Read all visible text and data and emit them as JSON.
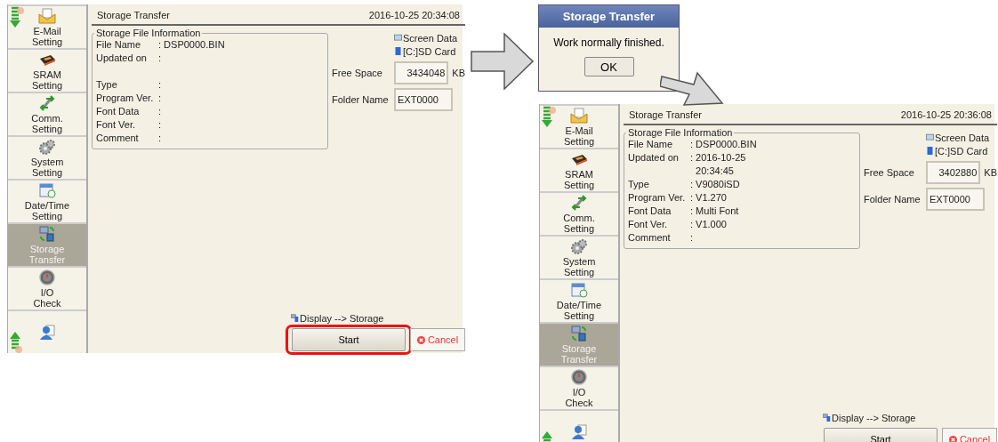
{
  "screens": [
    {
      "title": "Storage Transfer",
      "datetime": "2016-10-25  20:34:08",
      "sidebar": [
        {
          "label": "E-Mail\nSetting",
          "kind": "email",
          "selected": false
        },
        {
          "label": "SRAM\nSetting",
          "kind": "sram",
          "selected": false
        },
        {
          "label": "Comm.\nSetting",
          "kind": "comm",
          "selected": false
        },
        {
          "label": "System\nSetting",
          "kind": "system",
          "selected": false
        },
        {
          "label": "Date/Time\nSetting",
          "kind": "datetime",
          "selected": false
        },
        {
          "label": "Storage\nTransfer",
          "kind": "storage",
          "selected": true
        },
        {
          "label": "I/O\nCheck",
          "kind": "io",
          "selected": false
        },
        {
          "kind": "user",
          "selected": false
        }
      ],
      "info": {
        "title": "Storage File Information",
        "fields": [
          {
            "label": "File Name",
            "value": ": DSP0000.BIN"
          },
          {
            "label": "Updated on",
            "value": ":\n "
          },
          {
            "label": "Type",
            "value": ":"
          },
          {
            "label": "Program Ver.",
            "value": ":"
          },
          {
            "label": "Font Data",
            "value": ":"
          },
          {
            "label": "Font Ver.",
            "value": ":"
          },
          {
            "label": "Comment",
            "value": ":"
          }
        ]
      },
      "sources": [
        {
          "label": "Screen Data",
          "kind": "monitor"
        },
        {
          "label": "[C:]SD Card",
          "kind": "sdcard"
        }
      ],
      "free_space": {
        "label": "Free Space",
        "value": "3434048",
        "unit": "KB"
      },
      "folder": {
        "label": "Folder Name",
        "value": "EXT0000"
      },
      "direction": "Display --> Storage",
      "start": {
        "label": "Start",
        "highlighted": true
      },
      "cancel": {
        "label": "Cancel"
      }
    },
    {
      "title": "Storage Transfer",
      "datetime": "2016-10-25  20:36:08",
      "sidebar": [
        {
          "label": "E-Mail\nSetting",
          "kind": "email",
          "selected": false
        },
        {
          "label": "SRAM\nSetting",
          "kind": "sram",
          "selected": false
        },
        {
          "label": "Comm.\nSetting",
          "kind": "comm",
          "selected": false
        },
        {
          "label": "System\nSetting",
          "kind": "system",
          "selected": false
        },
        {
          "label": "Date/Time\nSetting",
          "kind": "datetime",
          "selected": false
        },
        {
          "label": "Storage\nTransfer",
          "kind": "storage",
          "selected": true
        },
        {
          "label": "I/O\nCheck",
          "kind": "io",
          "selected": false
        },
        {
          "kind": "user",
          "selected": false
        }
      ],
      "info": {
        "title": "Storage File Information",
        "fields": [
          {
            "label": "File Name",
            "value": ": DSP0000.BIN"
          },
          {
            "label": "Updated on",
            "value": ": 2016-10-25\n  20:34:45"
          },
          {
            "label": "Type",
            "value": ": V9080iSD"
          },
          {
            "label": "Program Ver.",
            "value": ": V1.270"
          },
          {
            "label": "Font Data",
            "value": ": Multi Font"
          },
          {
            "label": "Font Ver.",
            "value": ": V1.000"
          },
          {
            "label": "Comment",
            "value": ":"
          }
        ]
      },
      "sources": [
        {
          "label": "Screen Data",
          "kind": "monitor"
        },
        {
          "label": "[C:]SD Card",
          "kind": "sdcard"
        }
      ],
      "free_space": {
        "label": "Free Space",
        "value": "3402880",
        "unit": "KB"
      },
      "folder": {
        "label": "Folder Name",
        "value": "EXT0000"
      },
      "direction": "Display --> Storage",
      "start": {
        "label": "Start",
        "highlighted": false
      },
      "cancel": {
        "label": "Cancel"
      }
    }
  ],
  "dialog": {
    "title": "Storage Transfer",
    "message": "Work normally finished.",
    "button": "OK"
  }
}
